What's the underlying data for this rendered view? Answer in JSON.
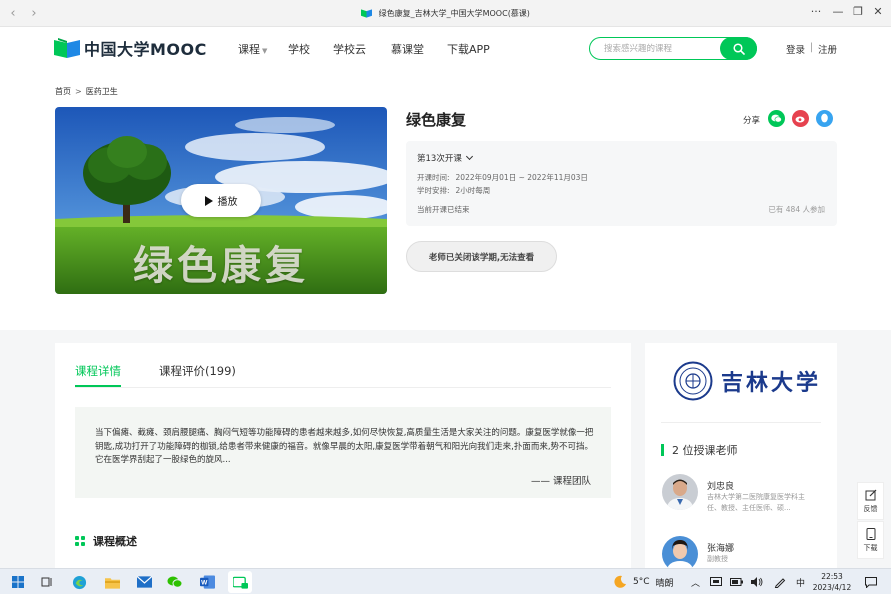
{
  "browser": {
    "title": "绿色康复_吉林大学_中国大学MOOC(慕课)",
    "back": "‹",
    "forward": "›",
    "more": "···",
    "minimize": "—",
    "restore": "❐",
    "close": "✕"
  },
  "header": {
    "logo": "中国大学MOOC",
    "nav": [
      "课程",
      "学校",
      "学校云",
      "慕课堂",
      "下载APP"
    ],
    "search_placeholder": "搜索感兴趣的课程",
    "login": "登录",
    "divider": "|",
    "register": "注册"
  },
  "breadcrumb": [
    "首页",
    "医药卫生"
  ],
  "breadcrumb_sep": ">",
  "course": {
    "cover_text": "绿色康复",
    "play_label": "播放",
    "title": "绿色康复",
    "share_label": "分享",
    "term": "第13次开课",
    "date_label": "开课时间:",
    "date_value": "2022年09月01日 ~ 2022年11月03日",
    "schedule_label": "学时安排:",
    "schedule_value": "2小时每周",
    "status": "当前开课已结束",
    "enrolled": "已有 484 人参加",
    "closed_button": "老师已关闭该学期,无法查看"
  },
  "tabs": [
    "课程详情",
    "课程评价(199)"
  ],
  "quote": {
    "text": "当下偏瘫、截瘫、颈肩腰腿痛、胸闷气短等功能障碍的患者越来越多,如何尽快恢复,高质量生活是大家关注的问题。康复医学就像一把钥匙,成功打开了功能障碍的枷锁,给患者带来健康的福音。就像早晨的太阳,康复医学带着朝气和阳光向我们走来,扑面而来,势不可挡。它在医学界刮起了一股绿色的旋风...",
    "sign": "—— 课程团队"
  },
  "overview_title": "课程概述",
  "side": {
    "university": "吉林大学",
    "teachers_title": "2 位授课老师",
    "teachers": [
      {
        "name": "刘忠良",
        "desc": "吉林大学第二医院康复医学科主任、教授、主任医师、硕..."
      },
      {
        "name": "张海娜",
        "desc": "副教授"
      }
    ]
  },
  "float_tools": [
    "反馈",
    "下载"
  ],
  "taskbar": {
    "temperature": "5°C",
    "weather": "晴朗",
    "ime": "中",
    "time": "22:53",
    "date": "2023/4/12"
  },
  "colors": {
    "accent": "#00c758",
    "brand_dark": "#1e2d3c",
    "university_blue": "#1b3a8c"
  }
}
